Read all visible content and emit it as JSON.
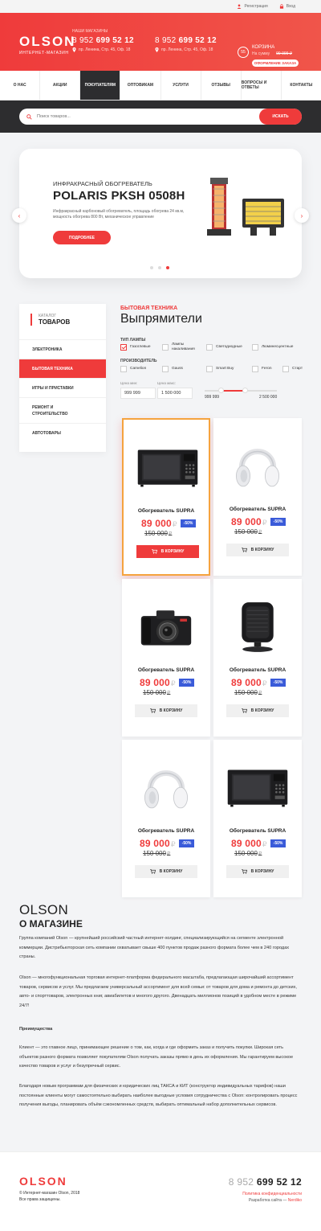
{
  "topbar": {
    "register": "Регистрация",
    "login": "Вход"
  },
  "header": {
    "logo": "OLSON",
    "logo_sub": "ИНТЕРНЕТ-МАГАЗИН",
    "shop_label": "НАШИ МАГАЗИНЫ",
    "shop1": {
      "phone_code": "8 952",
      "phone_num": "699 52 12",
      "address": "пр. Ленина, Стр. 45, Оф. 18"
    },
    "shop2": {
      "phone_code": "8 952",
      "phone_num": "699 52 12",
      "address": "пр. Ленина, Стр. 45, Оф. 18"
    },
    "cart": {
      "count": "55",
      "title": "КОРЗИНА",
      "sum_label": "На сумму",
      "sum": "99 999 ₽",
      "order_button": "ОФОРМЛЕНИЕ ЗАКАЗА"
    }
  },
  "nav": [
    "О НАС",
    "АКЦИИ",
    "ПОКУПАТЕЛЯМ",
    "ОПТОВИКАМ",
    "УСЛУГИ",
    "ОТЗЫВЫ",
    "ВОПРОСЫ И ОТВЕТЫ",
    "КОНТАКТЫ"
  ],
  "search": {
    "placeholder": "Поиск товаров...",
    "button": "ИСКАТЬ"
  },
  "slider": {
    "subtitle": "ИНФРАКРАСНЫЙ ОБОГРЕВАТЕЛЬ",
    "title": "POLARIS PKSH 0508H",
    "description": "Инфракрасный карбоновый обогреватель, площадь обогрева 24 кв.м, мощность обогрева 800 Вт, механическое управление",
    "button": "ПОДРОБНЕЕ",
    "active_slide": 3
  },
  "catalog": {
    "label": "КАТАЛОГ",
    "title": "ТОВАРОВ",
    "items": [
      "ЭЛЕКТРОНИКА",
      "БЫТОВАЯ ТЕХНИКА",
      "ИГРЫ И ПРИСТАВКИ",
      "РЕМОНТ И СТРОИТЕЛЬСТВО",
      "АВТОТОВАРЫ"
    ]
  },
  "category": {
    "label": "БЫТОВАЯ ТЕХНИКА",
    "title": "Выпрямители"
  },
  "filters": {
    "lamp_type_label": "ТИП ЛАМПЫ",
    "lamp_types": [
      "Газоглевые",
      "Лампы накаливания",
      "Светодиодные",
      "Люминесцентные"
    ],
    "manufacturer_label": "ПРОИЗВОДИТЕЛЬ",
    "manufacturers": [
      "Camelion",
      "Gauss",
      "Smart Buy",
      "Feron",
      "Старт"
    ],
    "price_min_label": "Цена мин:",
    "price_max_label": "Цена макс:",
    "price_min": "999 999",
    "price_max": "1 500 000",
    "range_min": "999 999",
    "range_max": "2 500 000"
  },
  "products": [
    {
      "name": "Обогреватель SUPRA",
      "price": "89 000",
      "old_price": "150 000",
      "discount": "-50%",
      "currency": "₽",
      "buy": "В КОРЗИНУ",
      "image": "microwave-icon"
    },
    {
      "name": "Обогреватель SUPRA",
      "price": "89 000",
      "old_price": "150 000",
      "discount": "-50%",
      "currency": "₽",
      "buy": "В КОРЗИНУ",
      "image": "headphones-icon"
    },
    {
      "name": "Обогреватель SUPRA",
      "price": "89 000",
      "old_price": "150 000",
      "discount": "-50%",
      "currency": "₽",
      "buy": "В КОРЗИНУ",
      "image": "camera-icon"
    },
    {
      "name": "Обогреватель SUPRA",
      "price": "89 000",
      "old_price": "150 000",
      "discount": "-50%",
      "currency": "₽",
      "buy": "В КОРЗИНУ",
      "image": "heater-icon"
    },
    {
      "name": "Обогреватель SUPRA",
      "price": "89 000",
      "old_price": "150 000",
      "discount": "-50%",
      "currency": "₽",
      "buy": "В КОРЗИНУ",
      "image": "headphones-icon"
    },
    {
      "name": "Обогреватель SUPRA",
      "price": "89 000",
      "old_price": "150 000",
      "discount": "-50%",
      "currency": "₽",
      "buy": "В КОРЗИНУ",
      "image": "microwave-icon"
    }
  ],
  "about": {
    "brand": "OLSON",
    "title": "О МАГАЗИНЕ",
    "p1": "Группа компаний Olson — крупнейший российский частный интернет-холдинг, специализирующийся на сегменте электронной коммерции. Дистрибьюторская сеть компании охватывает свыше 400 пунктов продаж разного формата более чем в 240 городах страны.",
    "p2": "Olson — многофункциональная торговая интернет-платформа федерального масштаба, предлагающая широчайший ассортимент товаров, сервисов и услуг. Мы предлагаем универсальный ассортимент для всей семьи: от товаров для дома и ремонта до детских, авто- и спорттоваров, электронных книг, авиабилетов и многого другого. Двенадцать миллионов позиций в удобном месте в режиме 24/7!",
    "p3_title": "Преимущества",
    "p4": "Клиент — это главное лицо, принимающее решение о том, как, когда и где оформить заказ и получить покупки. Широкая сеть объектов разного формата позволяет покупателям Olson получать заказы прямо в день их оформления. Мы гарантируем высокое качество товаров и услуг и безупречный сервис.",
    "p5": "Благодаря новым программам для физических и юридических лиц ТАКСА и КИТ (конструктор индивидуальных тарифов) наши постоянные клиенты могут самостоятельно выбирать наиболее выгодные условия сотрудничества с Olson: контролировать процесс получения выгоды, планировать объём сэкономленных средств, выбирать оптимальный набор дополнительных сервисов."
  },
  "footer": {
    "logo": "OLSON",
    "copyright1": "© Интернет-магазин Olson, 2018",
    "copyright2": "Все права защищены.",
    "phone_code": "8 952",
    "phone_num": "699 52 12",
    "privacy": "Политика конфиденциальности",
    "dev_label": "Разработка сайта —",
    "dev_name": "Nerdiko"
  },
  "colors": {
    "accent": "#ef3b3b",
    "dark": "#2d2d2f",
    "discount": "#3a5bd9"
  }
}
